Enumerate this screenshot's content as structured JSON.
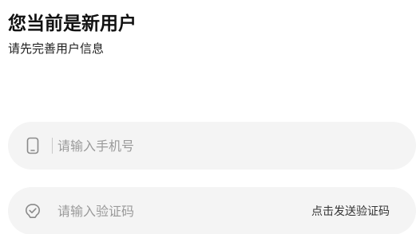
{
  "header": {
    "title": "您当前是新用户",
    "subtitle": "请先完善用户信息"
  },
  "phone_field": {
    "icon": "phone-icon",
    "placeholder": "请输入手机号",
    "value": ""
  },
  "code_field": {
    "icon": "verification-icon",
    "placeholder": "请输入验证码",
    "value": "",
    "send_code_label": "点击发送验证码"
  },
  "colors": {
    "field_background": "#f4f4f4",
    "placeholder": "#9a9a9a",
    "title": "#111111"
  }
}
